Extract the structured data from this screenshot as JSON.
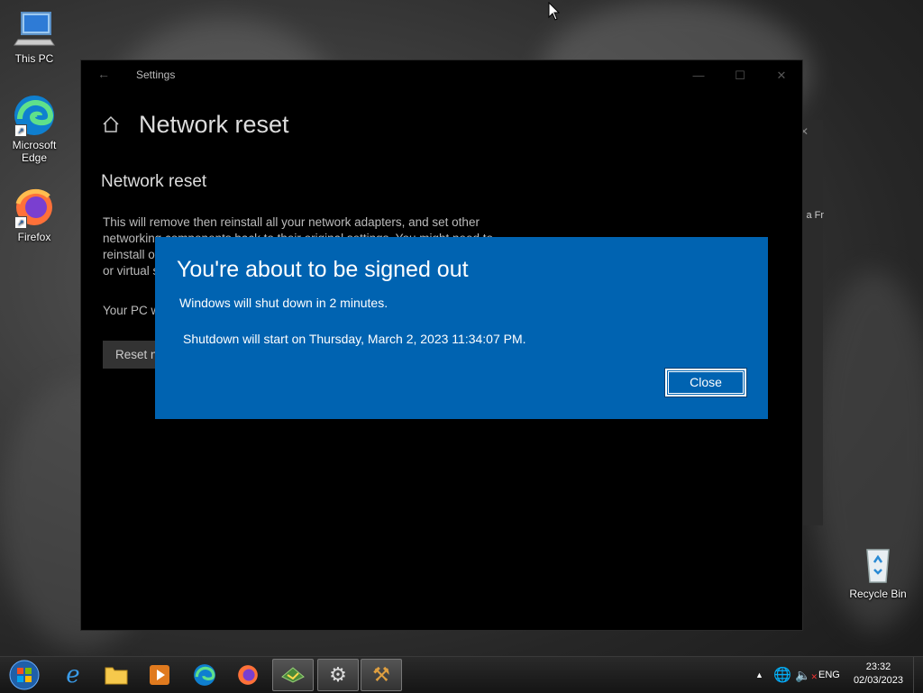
{
  "desktop": {
    "icons": [
      {
        "label": "This PC",
        "name": "this-pc"
      },
      {
        "label": "Microsoft Edge",
        "name": "microsoft-edge"
      },
      {
        "label": "Firefox",
        "name": "firefox"
      },
      {
        "label": "Recycle Bin",
        "name": "recycle-bin"
      }
    ],
    "background_window_text": "l a Fr"
  },
  "settings": {
    "app_title": "Settings",
    "page_title": "Network reset",
    "section_title": "Network reset",
    "description": "This will remove then reinstall all your network adapters, and set other networking components back to their original settings. You might need to reinstall other networking software afterwards, such as VPN client software or virtual switches.",
    "pc_text": "Your PC will restart.",
    "reset_button": "Reset now"
  },
  "dialog": {
    "title": "You're about to be signed out",
    "line1": "Windows will shut down in 2 minutes.",
    "line2": "Shutdown will start on Thursday, March 2, 2023 11:34:07 PM.",
    "close_label": "Close"
  },
  "taskbar": {
    "apps": [
      "internet-explorer",
      "file-explorer",
      "media-player",
      "edge",
      "firefox",
      "network-app",
      "settings",
      "tools"
    ],
    "language": "ENG",
    "time": "23:32",
    "date": "02/03/2023"
  },
  "colors": {
    "dialog_bg": "#0063b1",
    "settings_bg": "#000000"
  }
}
